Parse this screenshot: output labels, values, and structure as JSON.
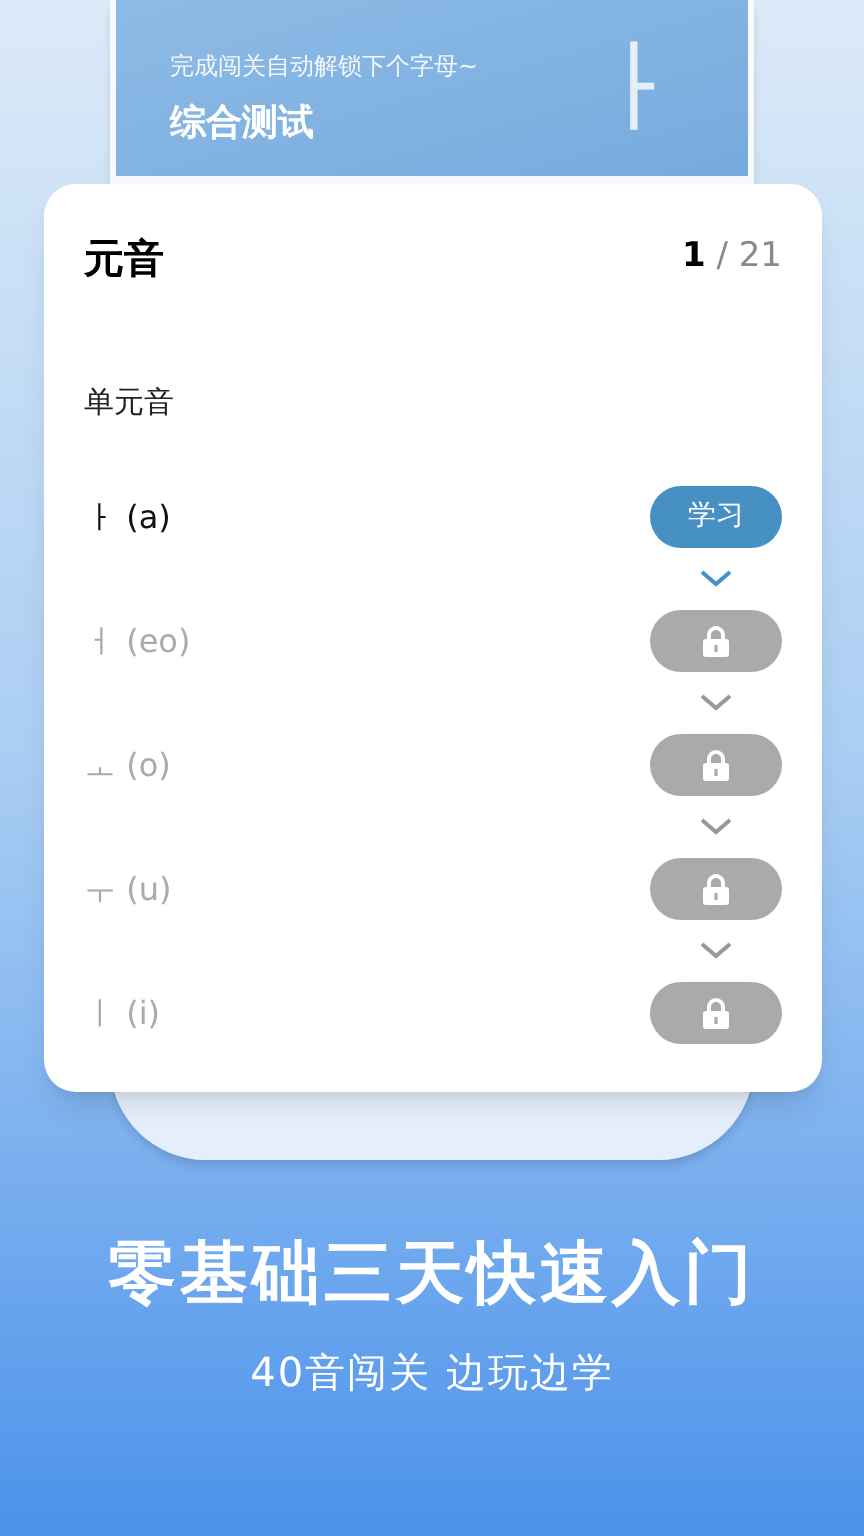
{
  "background_card": {
    "hint": "完成闯关自动解锁下个字母~",
    "title": "综合测试",
    "letter": "ㅏ"
  },
  "panel": {
    "title": "元音",
    "counter": "**1** / 21",
    "section": "单元音",
    "rows": [
      {
        "letter": "ㅏ (a)",
        "unlocked": true,
        "button": "学习"
      },
      {
        "letter": "ㅓ (eo)",
        "unlocked": false
      },
      {
        "letter": "ㅗ (o)",
        "unlocked": false
      },
      {
        "letter": "ㅜ (u)",
        "unlocked": false
      },
      {
        "letter": "ㅣ (i)",
        "unlocked": false
      }
    ]
  },
  "slogan": "零基础三天快速入门",
  "subtitle": "40音闯关 边玩边学"
}
